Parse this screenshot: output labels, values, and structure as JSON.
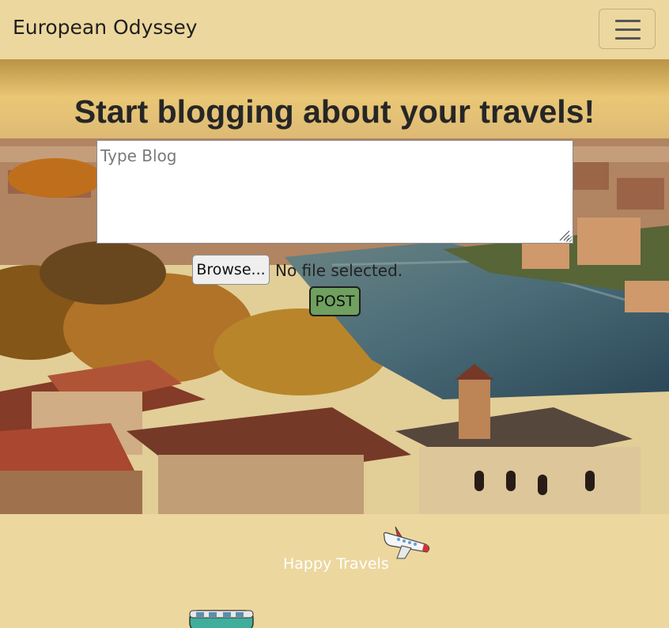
{
  "navbar": {
    "brand": "European Odyssey",
    "toggler_icon": "hamburger-menu-icon"
  },
  "hero": {
    "title": "Start blogging about your travels!",
    "blog_placeholder": "Type Blog",
    "blog_value": "",
    "file_button_label": "Browse...",
    "file_status": "No file selected.",
    "post_label": "POST"
  },
  "footer": {
    "text": "Happy Travels",
    "icons": [
      "airplane-icon",
      "train-icon"
    ]
  },
  "colors": {
    "page_background": "#ecd79e",
    "post_button": "#6fa05f",
    "title_text": "#262626"
  }
}
